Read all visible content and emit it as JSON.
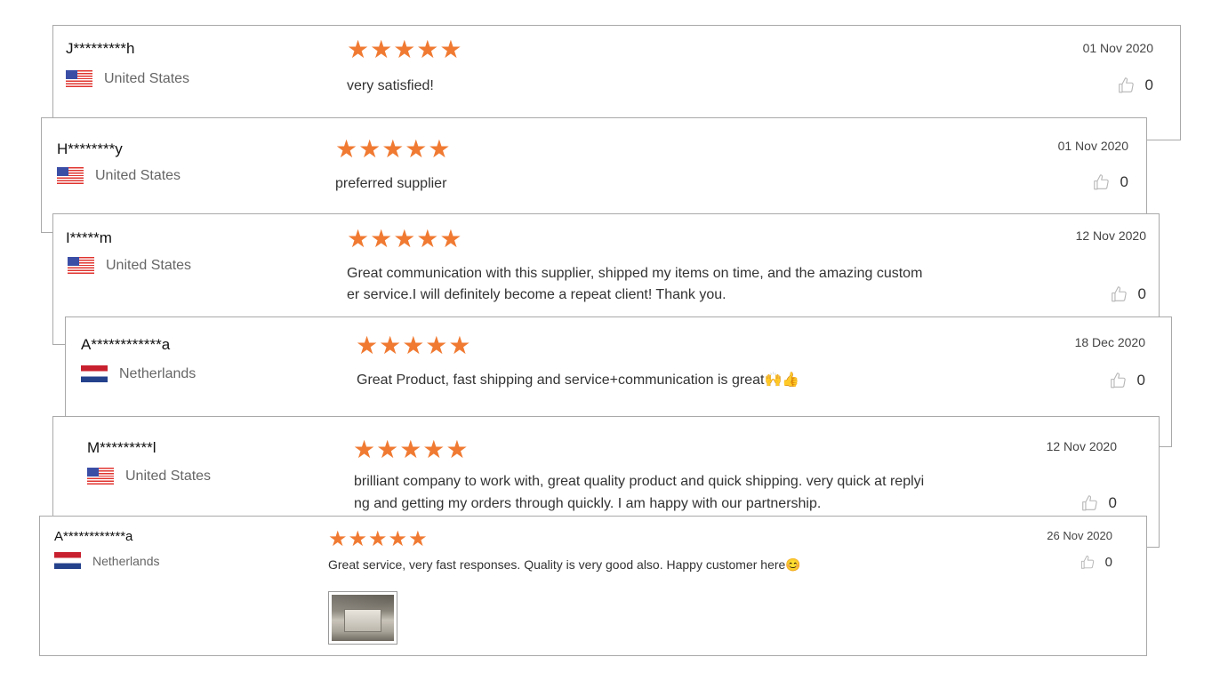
{
  "reviews": [
    {
      "name": "J*********h",
      "country": "United States",
      "flag": "us",
      "stars": "★★★★★",
      "text_lines": [
        "very satisfied!",
        ""
      ],
      "date": "01 Nov 2020",
      "likes": "0"
    },
    {
      "name": "H********y",
      "country": "United States",
      "flag": "us",
      "stars": "★★★★★",
      "text_lines": [
        "preferred supplier",
        ""
      ],
      "date": "01 Nov 2020",
      "likes": "0"
    },
    {
      "name": "I*****m",
      "country": "United States",
      "flag": "us",
      "stars": "★★★★★",
      "text_lines": [
        "Great communication with this supplier, shipped my items on time, and the amazing custom",
        "er service.I will definitely become a repeat client! Thank you."
      ],
      "date": "12 Nov 2020",
      "likes": "0"
    },
    {
      "name": "A************a",
      "country": "Netherlands",
      "flag": "nl",
      "stars": "★★★★★",
      "text_lines": [
        "Great Product, fast shipping and service+communication is great🙌👍",
        ""
      ],
      "date": "18 Dec 2020",
      "likes": "0"
    },
    {
      "name": "M*********l",
      "country": "United States",
      "flag": "us",
      "stars": "★★★★★",
      "text_lines": [
        "brilliant company to work with, great quality product and quick shipping. very quick at replyi",
        "ng and getting my orders through quickly. I am happy with our partnership."
      ],
      "date": "12 Nov 2020",
      "likes": "0"
    },
    {
      "name": "A************a",
      "country": "Netherlands",
      "flag": "nl",
      "stars": "★★★★★",
      "text_lines": [
        "Great service, very fast responses. Quality is very good also. Happy customer here😊",
        ""
      ],
      "date": "26 Nov 2020",
      "likes": "0",
      "has_photo": true
    }
  ],
  "colors": {
    "star": "#f07a32",
    "border": "#a9a9a9"
  },
  "icons": {
    "like": "thumbs-up-icon"
  }
}
